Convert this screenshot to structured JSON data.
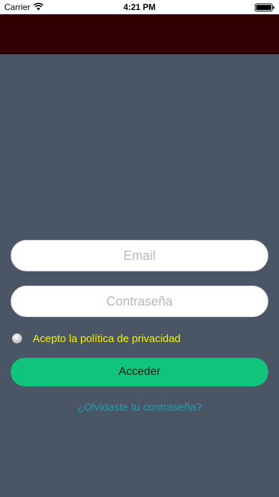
{
  "status_bar": {
    "carrier": "Carrier",
    "time": "4:21 PM",
    "wifi_icon": "wifi-icon",
    "battery_icon": "battery-icon"
  },
  "colors": {
    "header_band": "#2f0003",
    "background": "#4a5566",
    "accent_button": "#10c47c",
    "privacy_text": "#f5f200",
    "link": "#1e9fb0"
  },
  "form": {
    "email": {
      "placeholder": "Email",
      "value": ""
    },
    "password": {
      "placeholder": "Contraseña",
      "value": ""
    },
    "privacy_label": "Acepto la política de privacidad",
    "privacy_checked": false,
    "submit_label": "Acceder",
    "forgot_label": "¿Olvidaste tu contraseña?"
  }
}
